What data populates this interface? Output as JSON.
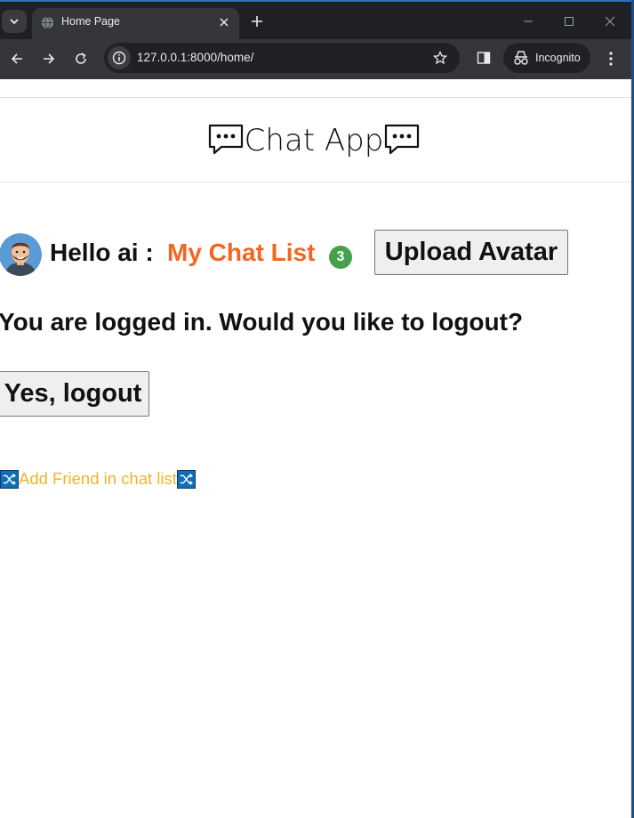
{
  "browser": {
    "tab_title": "Home Page",
    "url": "127.0.0.1:8000/home/",
    "incognito_label": "Incognito"
  },
  "page": {
    "site_title": "Chat App",
    "greeting": "Hello ai : ",
    "chat_list_link": "My Chat List",
    "chat_list_count": "3",
    "upload_avatar_button": "Upload Avatar",
    "logout_question": "You are logged in. Would you like to logout?",
    "logout_button": "Yes, logout",
    "add_friend_link": "Add Friend in chat list"
  },
  "icons": {
    "title_left": "speech-bubble-icon",
    "title_right": "speech-bubble-icon",
    "avatar": "avatar",
    "add_friend_left": "shuffle-icon",
    "add_friend_right": "shuffle-icon"
  },
  "colors": {
    "link_orange": "#f26522",
    "badge_green": "#45a14d",
    "add_friend_yellow": "#f0b429",
    "chrome_dark": "#35363a"
  }
}
